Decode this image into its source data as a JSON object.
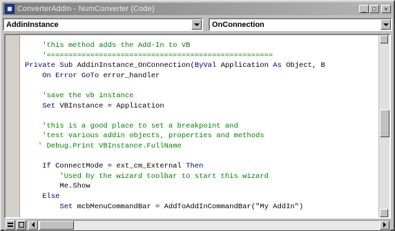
{
  "window": {
    "title": "ConverterAddIn - NumConverter (Code)",
    "icon": "vb-code-window-icon",
    "controls": [
      "minimize",
      "maximize",
      "close"
    ]
  },
  "object_combo": {
    "selected": "AddinInstance"
  },
  "procedure_combo": {
    "selected": "OnConnection"
  },
  "code_lines": [
    {
      "segments": [
        {
          "t": "    'this method adds the Add-In to VB",
          "c": "c"
        }
      ]
    },
    {
      "segments": [
        {
          "t": "    '====================================================",
          "c": "c"
        }
      ]
    },
    {
      "segments": [
        {
          "t": "Private Sub ",
          "c": "k"
        },
        {
          "t": "AddinInstance_OnConnection(",
          "c": ""
        },
        {
          "t": "ByVal",
          "c": "k"
        },
        {
          "t": " Application ",
          "c": ""
        },
        {
          "t": "As",
          "c": "k"
        },
        {
          "t": " Object, B",
          "c": ""
        }
      ]
    },
    {
      "segments": [
        {
          "t": "    ",
          "c": ""
        },
        {
          "t": "On Error GoTo",
          "c": "k"
        },
        {
          "t": " error_handler",
          "c": ""
        }
      ]
    },
    {
      "segments": [
        {
          "t": "",
          "c": ""
        }
      ]
    },
    {
      "segments": [
        {
          "t": "    'save the vb instance",
          "c": "c"
        }
      ]
    },
    {
      "segments": [
        {
          "t": "    ",
          "c": ""
        },
        {
          "t": "Set",
          "c": "k"
        },
        {
          "t": " VBInstance = Application",
          "c": ""
        }
      ]
    },
    {
      "segments": [
        {
          "t": "",
          "c": ""
        }
      ]
    },
    {
      "segments": [
        {
          "t": "    'this is a good place to set a breakpoint and",
          "c": "c"
        }
      ]
    },
    {
      "segments": [
        {
          "t": "    'test various addin objects, properties and methods",
          "c": "c"
        }
      ]
    },
    {
      "segments": [
        {
          "t": "   ' Debug.Print VBInstance.FullName",
          "c": "c"
        }
      ]
    },
    {
      "segments": [
        {
          "t": "",
          "c": ""
        }
      ]
    },
    {
      "segments": [
        {
          "t": "    ",
          "c": ""
        },
        {
          "t": "If",
          "c": "k"
        },
        {
          "t": " ConnectMode = ext_cm_External ",
          "c": ""
        },
        {
          "t": "Then",
          "c": "k"
        }
      ]
    },
    {
      "segments": [
        {
          "t": "        'Used by the wizard toolbar to start this wizard",
          "c": "c"
        }
      ]
    },
    {
      "segments": [
        {
          "t": "        Me.Show",
          "c": ""
        }
      ]
    },
    {
      "segments": [
        {
          "t": "    ",
          "c": ""
        },
        {
          "t": "Else",
          "c": "k"
        }
      ]
    },
    {
      "segments": [
        {
          "t": "        ",
          "c": ""
        },
        {
          "t": "Set",
          "c": "k"
        },
        {
          "t": " mcbMenuCommandBar = AddToAddInCommandBar(\"My AddIn\")",
          "c": ""
        }
      ]
    }
  ],
  "colors": {
    "comment": "#008000",
    "keyword": "#00007f",
    "text": "#000000"
  }
}
